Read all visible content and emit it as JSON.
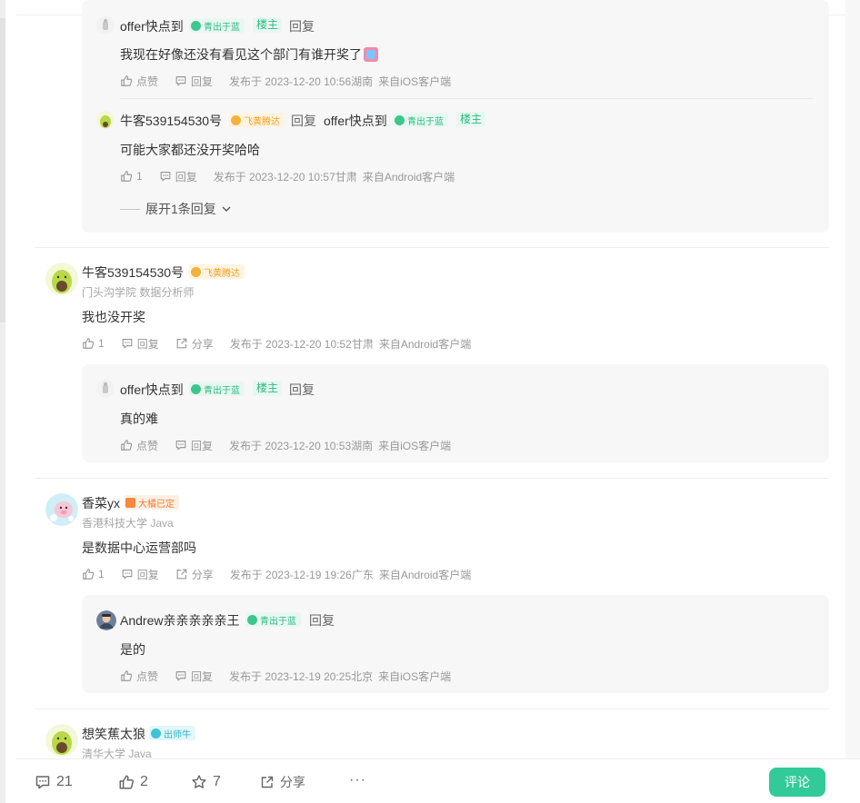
{
  "thread": {
    "reply_a": {
      "author": "offer快点到",
      "badge": "青出于蓝",
      "op_tag": "楼主",
      "reply_label": "回复",
      "content": "我现在好像还没有看见这个部门有谁开奖了",
      "actions": {
        "like": "点赞",
        "reply": "回复"
      },
      "posted": "发布于 2023-12-20 10:56",
      "location": "湖南",
      "client": "来自iOS客户端"
    },
    "reply_b": {
      "author": "牛客539154530号",
      "badge": "飞黄腾达",
      "reply_label": "回复",
      "target": "offer快点到",
      "target_badge": "青出于蓝",
      "target_tag": "楼主",
      "content": "可能大家都还没开奖哈哈",
      "actions": {
        "like": "1",
        "reply": "回复"
      },
      "posted": "发布于 2023-12-20 10:57",
      "location": "甘肃",
      "client": "来自Android客户端"
    },
    "expand_label": "展开1条回复"
  },
  "comments": [
    {
      "author": "牛客539154530号",
      "badge": "飞黄腾达",
      "sub": "门头沟学院 数据分析师",
      "content": "我也没开奖",
      "actions": {
        "like": "1",
        "reply": "回复",
        "share": "分享"
      },
      "posted": "发布于 2023-12-20 10:52",
      "location": "甘肃",
      "client": "来自Android客户端",
      "reply": {
        "author": "offer快点到",
        "badge": "青出于蓝",
        "op_tag": "楼主",
        "reply_label": "回复",
        "content": "真的难",
        "actions": {
          "like": "点赞",
          "reply": "回复"
        },
        "posted": "发布于 2023-12-20 10:53",
        "location": "湖南",
        "client": "来自iOS客户端"
      }
    },
    {
      "author": "香菜yx",
      "badge": "大橘已定",
      "sub": "香港科技大学 Java",
      "content": "是数据中心运营部吗",
      "actions": {
        "like": "1",
        "reply": "回复",
        "share": "分享"
      },
      "posted": "发布于 2023-12-19 19:26",
      "location": "广东",
      "client": "来自Android客户端",
      "reply": {
        "author": "Andrew亲亲亲亲亲王",
        "badge": "青出于蓝",
        "reply_label": "回复",
        "content": "是的",
        "actions": {
          "like": "点赞",
          "reply": "回复"
        },
        "posted": "发布于 2023-12-19 20:25",
        "location": "北京",
        "client": "来自iOS客户端"
      }
    },
    {
      "author": "想笑蕉太狼",
      "badge": "出师牛",
      "sub": "清华大学 Java"
    }
  ],
  "bottom_bar": {
    "comments": "21",
    "likes": "2",
    "stars": "7",
    "share": "分享",
    "more": "···",
    "comment_button": "评论"
  },
  "colors": {
    "accent": "#32ca99",
    "green_badge": "#2dbb82",
    "gold_badge": "#f0a020",
    "orange_badge": "#f07c2a",
    "cyan_badge": "#27b3c9"
  },
  "icons": [
    "like-icon",
    "reply-icon",
    "share-icon",
    "comment-icon",
    "star-icon",
    "more-icon",
    "chevron-down-icon",
    "badge-icon"
  ]
}
